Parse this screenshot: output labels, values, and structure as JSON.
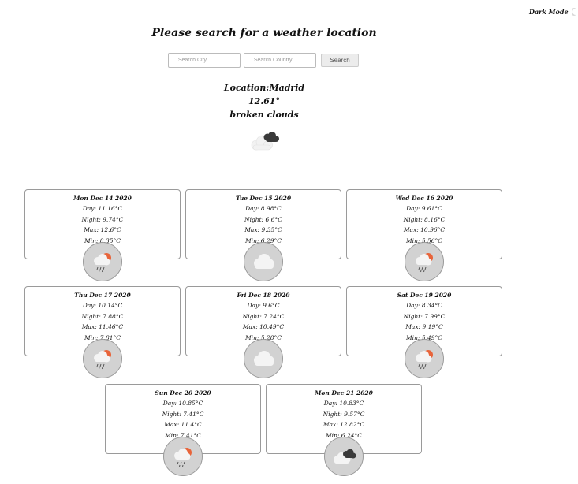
{
  "dark_mode": {
    "label": "Dark Mode",
    "enabled": false
  },
  "title": "Please search for a weather location",
  "search": {
    "city_placeholder": "...Search City",
    "country_placeholder": "...Search Country",
    "button_label": "Search"
  },
  "current": {
    "location": "Location:Madrid",
    "temp": "12.61°",
    "desc": "broken clouds",
    "icon": "broken-clouds-icon"
  },
  "forecast": [
    {
      "date": "Mon Dec 14 2020",
      "day": "Day: 11.16°C",
      "night": "Night: 9.74°C",
      "max": "Max: 12.6°C",
      "min": "Min: 8.35°C",
      "icon": "rain-sun-icon"
    },
    {
      "date": "Tue Dec 15 2020",
      "day": "Day: 8.98°C",
      "night": "Night: 6.6°C",
      "max": "Max: 9.35°C",
      "min": "Min: 6.29°C",
      "icon": "cloud-icon"
    },
    {
      "date": "Wed Dec 16 2020",
      "day": "Day: 9.61°C",
      "night": "Night: 8.16°C",
      "max": "Max: 10.96°C",
      "min": "Min: 5.56°C",
      "icon": "rain-sun-icon"
    },
    {
      "date": "Thu Dec 17 2020",
      "day": "Day: 10.14°C",
      "night": "Night: 7.88°C",
      "max": "Max: 11.46°C",
      "min": "Min: 7.81°C",
      "icon": "rain-sun-icon"
    },
    {
      "date": "Fri Dec 18 2020",
      "day": "Day: 9.6°C",
      "night": "Night: 7.24°C",
      "max": "Max: 10.49°C",
      "min": "Min: 5.28°C",
      "icon": "cloud-icon"
    },
    {
      "date": "Sat Dec 19 2020",
      "day": "Day: 8.34°C",
      "night": "Night: 7.99°C",
      "max": "Max: 9.19°C",
      "min": "Min: 5.49°C",
      "icon": "rain-sun-icon"
    },
    {
      "date": "Sun Dec 20 2020",
      "day": "Day: 10.85°C",
      "night": "Night: 7.41°C",
      "max": "Max: 11.4°C",
      "min": "Min: 7.41°C",
      "icon": "rain-sun-icon"
    },
    {
      "date": "Mon Dec 21 2020",
      "day": "Day: 10.83°C",
      "night": "Night: 9.57°C",
      "max": "Max: 12.82°C",
      "min": "Min: 6.24°C",
      "icon": "broken-clouds-icon"
    }
  ],
  "colors": {
    "sun": "#e8643a",
    "cloud": "#f4f4f4",
    "dark_cloud": "#3a3a3a",
    "circle": "#d2d2d2"
  }
}
